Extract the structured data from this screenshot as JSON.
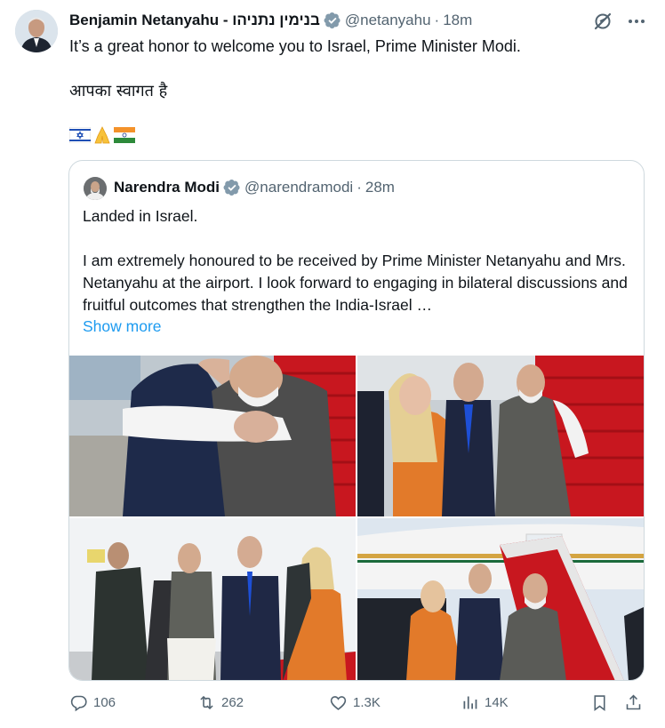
{
  "tweet": {
    "author_name": "Benjamin Netanyahu - בנימין נתניהו",
    "handle": "@netanyahu",
    "separator": "·",
    "time": "18m",
    "text_line1": "It’s a great honor to welcome you to Israel, Prime Minister Modi.",
    "text_line2": "आपका स्वागत है",
    "emoji": "🇮🇱🙏🇮🇳",
    "verified": true
  },
  "quoted": {
    "author_name": "Narendra Modi",
    "handle": "@narendramodi",
    "separator": "·",
    "time": "28m",
    "text_line1": "Landed in Israel.",
    "text_para2": "I am extremely honoured to be received by Prime Minister Netanyahu and Mrs. Netanyahu at the airport. I look forward to engaging in bilateral discussions and fruitful outcomes that strengthen the India-Israel …",
    "show_more": "Show more",
    "verified": true
  },
  "actions": {
    "replies": "106",
    "reposts": "262",
    "likes": "1.3K",
    "views": "14K"
  },
  "icons": {
    "verified": "verified-badge-icon",
    "grok": "grok-icon",
    "more": "more-icon",
    "reply": "reply-icon",
    "repost": "repost-icon",
    "like": "heart-icon",
    "views": "views-icon",
    "bookmark": "bookmark-icon",
    "share": "share-icon"
  },
  "colors": {
    "accent": "#1d9bf0",
    "secondary_text": "#536471",
    "border": "#cfd9de",
    "text": "#0f1419"
  }
}
